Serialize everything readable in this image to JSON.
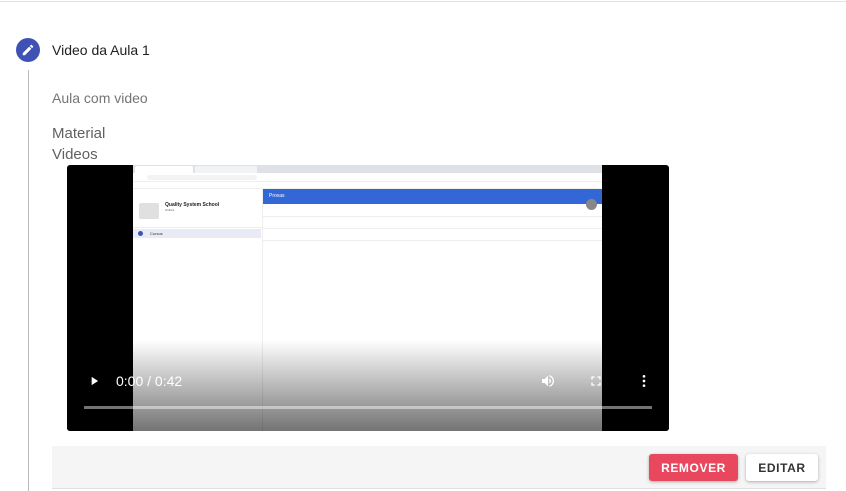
{
  "step": {
    "title": "Video da Aula 1",
    "icon": "pencil-icon",
    "icon_color": "#3f51b5"
  },
  "lesson": {
    "description": "Aula com video",
    "material_label": "Material",
    "videos_label": "Videos"
  },
  "video": {
    "time": "0:00 / 0:42",
    "progress": 0,
    "frame": {
      "school_name": "Quality System School",
      "school_sub": "Oxford",
      "menu_item": "Cursos",
      "appbar_title": "Provas"
    }
  },
  "actions": {
    "remove_label": "REMOVER",
    "edit_label": "EDITAR",
    "remove_color": "#e8475d"
  }
}
